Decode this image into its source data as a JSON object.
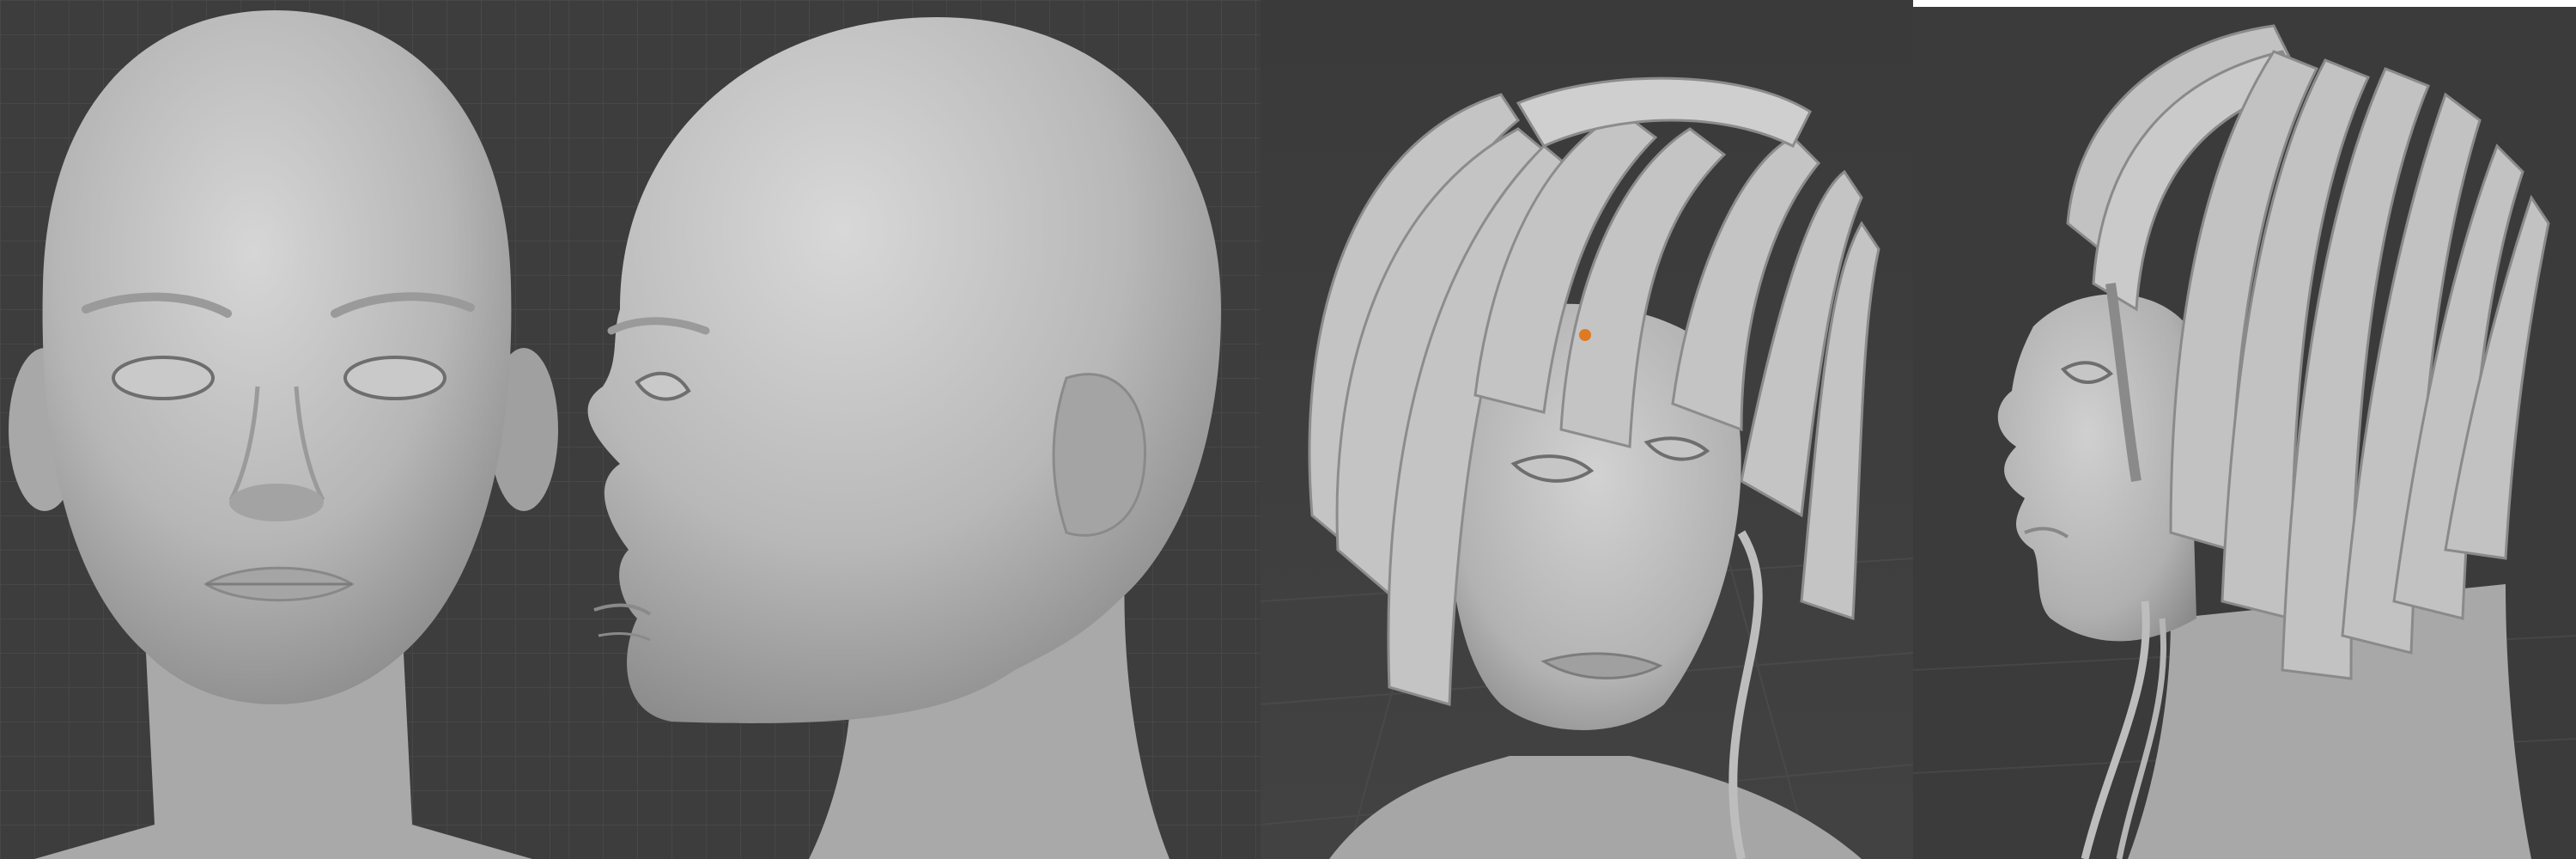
{
  "viewports": [
    {
      "view": "front",
      "subject": "bald-head-sculpt"
    },
    {
      "view": "side",
      "subject": "bald-head-sculpt"
    },
    {
      "view": "three-quarter",
      "subject": "head-with-hair-cards"
    },
    {
      "view": "side",
      "subject": "head-with-hair-cards"
    }
  ],
  "colors": {
    "viewport_bg": "#3d3d3d",
    "grid_line": "#474747",
    "clay": "#b8b8b8",
    "clay_shadow": "#8e8e8e",
    "clay_highlight": "#d4d4d4",
    "origin_marker": "#e07a22"
  }
}
